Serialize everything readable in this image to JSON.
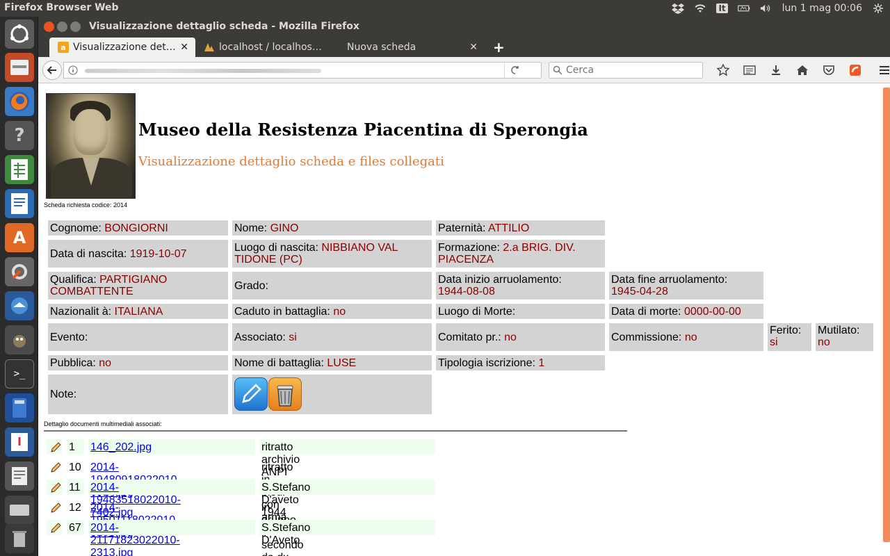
{
  "system": {
    "app_title": "Firefox Browser Web",
    "keyboard_layout": "It",
    "clock": "lun  1 mag 00:06"
  },
  "window": {
    "title": "Visualizzazione dettaglio scheda - Mozilla Firefox"
  },
  "tabs": [
    {
      "label": "Visualizzazione det…"
    },
    {
      "label": "localhost / localhos…"
    },
    {
      "label": "Nuova scheda"
    }
  ],
  "search": {
    "placeholder": "Cerca"
  },
  "page": {
    "title": "Museo della Resistenza Piacentina di Sperongia",
    "subtitle": "Visualizzazione dettaglio scheda e files collegati",
    "code_note": "Scheda richiesta codice: 2014",
    "fields": {
      "cognome": {
        "label": "Cognome: ",
        "value": "BONGIORNI"
      },
      "nome": {
        "label": "Nome: ",
        "value": "GINO"
      },
      "paternita": {
        "label": "Paternità: ",
        "value": "ATTILIO"
      },
      "data_nascita": {
        "label": "Data di nascita: ",
        "value": "1919-10-07"
      },
      "luogo_nascita": {
        "label": "Luogo di nascita: ",
        "value": "NIBBIANO VAL TIDONE (PC)"
      },
      "formazione": {
        "label": "Formazione: ",
        "value": "2.a BRIG. DIV. PIACENZA"
      },
      "qualifica": {
        "label": "Qualifica: ",
        "value": "PARTIGIANO COMBATTENTE"
      },
      "grado": {
        "label": "Grado:",
        "value": ""
      },
      "data_inizio": {
        "label": "Data inizio arruolamento:",
        "value": "1944-08-08"
      },
      "data_fine": {
        "label": "Data fine arruolamento:",
        "value": "1945-04-28"
      },
      "nazionalita": {
        "label": "Nazionalit à: ",
        "value": "ITALIANA"
      },
      "caduto": {
        "label": "Caduto in battaglia: ",
        "value": "no"
      },
      "luogo_morte": {
        "label": "Luogo di Morte:",
        "value": ""
      },
      "data_morte": {
        "label": "Data di morte: ",
        "value": "0000-00-00"
      },
      "evento": {
        "label": "Evento:",
        "value": ""
      },
      "associato": {
        "label": "Associato: ",
        "value": "si"
      },
      "comitato": {
        "label": "Comitato pr.: ",
        "value": "no"
      },
      "commissione": {
        "label": "Commissione: ",
        "value": "no"
      },
      "ferito": {
        "label": "Ferito:",
        "value": "si"
      },
      "mutilato": {
        "label": "Mutilato:",
        "value": "no"
      },
      "pubblica": {
        "label": "Pubblica: ",
        "value": "no"
      },
      "nome_battaglia": {
        "label": "Nome di battaglia: ",
        "value": "LUSE"
      },
      "tipologia": {
        "label": "Tipologia iscrizione: ",
        "value": "1"
      },
      "note": {
        "label": "Note:",
        "value": ""
      }
    },
    "documents_label": "Dettaglio documenti multimediali associati:",
    "documents": [
      {
        "num": "1",
        "file": "146_202.jpg",
        "desc": "ritratto archivio ANPI provinciale"
      },
      {
        "num": "10",
        "file": "2014-19480918022010-6914.jpg",
        "desc": "ritratto in piedi con arma"
      },
      {
        "num": "11",
        "file": "2014-19483518022010-7402.jpg",
        "desc": "S.Stefano D'aveto 1944"
      },
      {
        "num": "12",
        "file": "2014-19501118022010-5185.jpg",
        "desc": "in gruppo, il secondo da dx davanti"
      },
      {
        "num": "67",
        "file": "2014-21171823022010-2313.jpg",
        "desc": "S.Stefano D'Aveto"
      }
    ]
  },
  "colors": {
    "value_text": "#8b0000",
    "subtitle": "#e8782b",
    "cell_bg": "#d3d3d3",
    "ubuntu_orange": "#e95420"
  }
}
